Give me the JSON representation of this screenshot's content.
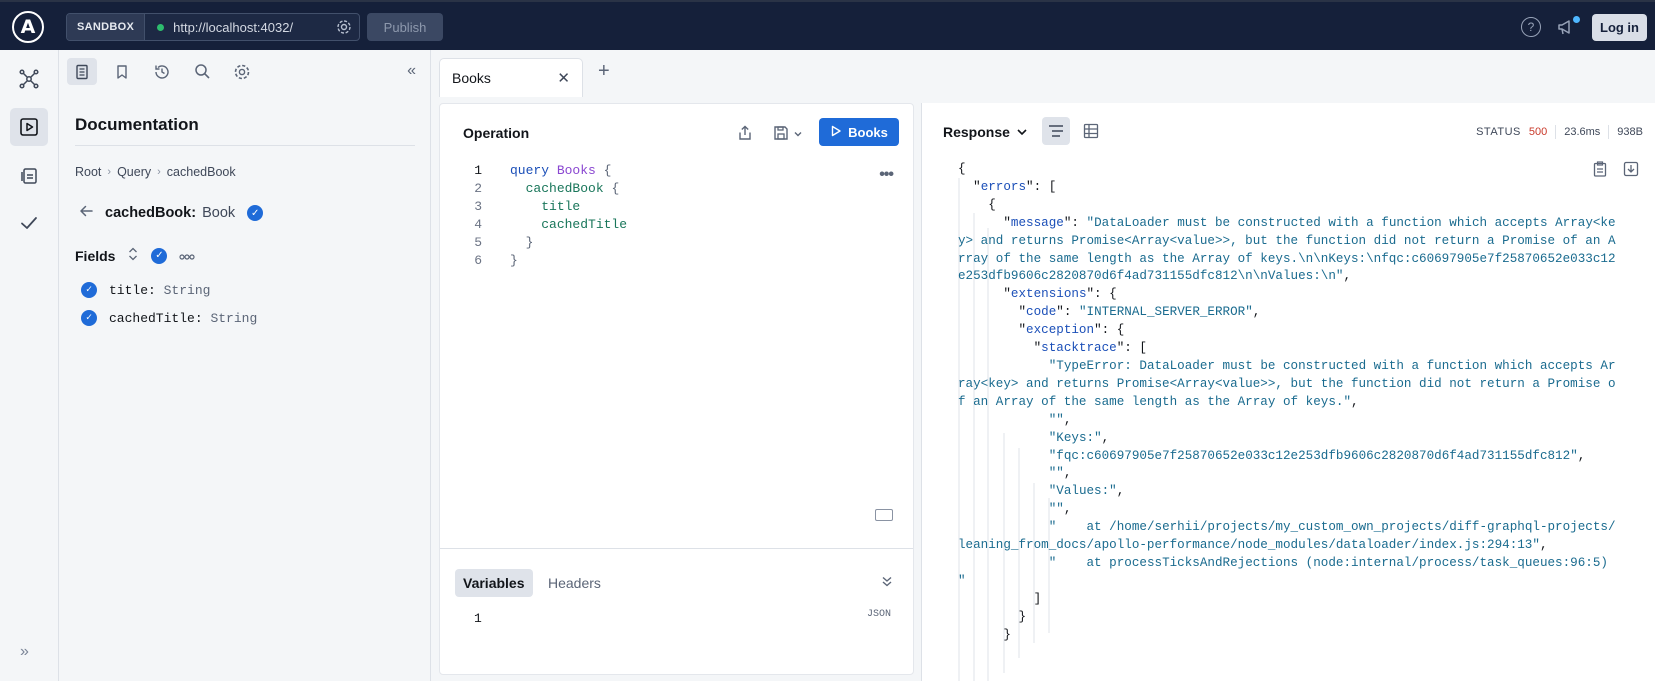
{
  "topbar": {
    "logo_letter": "A",
    "sandbox_label": "SANDBOX",
    "url": "http://localhost:4032/",
    "publish_label": "Publish",
    "help_symbol": "?",
    "login_label": "Log in"
  },
  "rail": {
    "items": [
      {
        "name": "schema-graph-icon"
      },
      {
        "name": "explorer-play-icon",
        "active": true
      },
      {
        "name": "checks-clipboard-icon"
      },
      {
        "name": "checkmark-icon"
      }
    ],
    "expand_symbol": "»"
  },
  "docs": {
    "toolbar": [
      "documentation-icon",
      "bookmark-icon",
      "history-icon",
      "search-icon",
      "gear-icon"
    ],
    "collapse_symbol": "«",
    "title": "Documentation",
    "breadcrumb": [
      "Root",
      "Query",
      "cachedBook"
    ],
    "breadcrumb_sep": "›",
    "field_name": "cachedBook:",
    "field_type": "Book",
    "fields_label": "Fields",
    "fields": [
      {
        "name": "title:",
        "type": "String"
      },
      {
        "name": "cachedTitle:",
        "type": "String"
      }
    ]
  },
  "tabs": {
    "items": [
      {
        "label": "Books"
      }
    ],
    "close_symbol": "✕",
    "add_symbol": "+"
  },
  "operation": {
    "title": "Operation",
    "run_label": "Books",
    "lines": [
      {
        "n": "1"
      },
      {
        "n": "2"
      },
      {
        "n": "3"
      },
      {
        "n": "4"
      },
      {
        "n": "5"
      },
      {
        "n": "6"
      }
    ],
    "code": {
      "kw": "query",
      "name": "Books",
      "open": "{",
      "field1": "cachedBook",
      "field1_open": "{",
      "sub1": "title",
      "sub2": "cachedTitle",
      "close_inner": "}",
      "close_outer": "}"
    },
    "variables_tab": "Variables",
    "headers_tab": "Headers",
    "json_label": "JSON",
    "var_line": "1"
  },
  "response": {
    "title": "Response",
    "status_label": "STATUS",
    "status_code": "500",
    "time": "23.6ms",
    "size": "938B",
    "message": "DataLoader must be constructed with a function which accepts Array<key> and returns Promise<Array<value>>, but the function did not return a Promise of an Array of the same length as the Array of keys.\\n\\nKeys:\\nfqc:c60697905e7f25870652e033c12e253dfb9606c2820870d6f4ad731155dfc812\\n\\nValues:\\n",
    "code": "INTERNAL_SERVER_ERROR",
    "stack": [
      "TypeError: DataLoader must be constructed with a function which accepts Array<key> and returns Promise<Array<value>>, but the function did not return a Promise of an Array of the same length as the Array of keys.",
      "",
      "Keys:",
      "fqc:c60697905e7f25870652e033c12e253dfb9606c2820870d6f4ad731155dfc812",
      "",
      "Values:",
      "",
      "    at /home/serhii/projects/my_custom_own_projects/diff-graphql-projects/leaning_from_docs/apollo-performance/node_modules/dataloader/index.js:294:13",
      "    at processTicksAndRejections (node:internal/process/task_queues:96:5)\n"
    ]
  }
}
